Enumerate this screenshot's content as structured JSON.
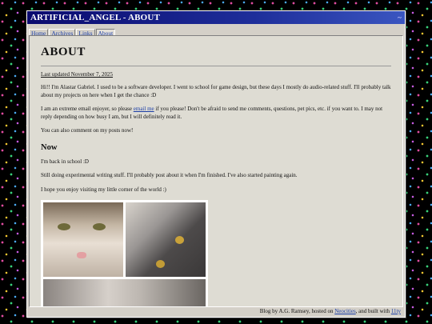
{
  "window": {
    "title": "ARTIFICIAL_ANGEL - ABOUT",
    "control": "~"
  },
  "nav": [
    {
      "label": "Home"
    },
    {
      "label": "Archives"
    },
    {
      "label": "Links"
    },
    {
      "label": "About"
    }
  ],
  "page": {
    "heading": "ABOUT",
    "updated": "Last updated November 7, 2025",
    "intro": "Hi!! I'm Alastar Gabriel. I used to be a software developer. I went to school for game design, but these days I mostly do audio-related stuff. I'll probably talk about my projects on here when I get the chance :D",
    "email_before": "I am an extreme email enjoyer, so please ",
    "email_link": "email me",
    "email_after": " if you please! Don't be afraid to send me comments, questions, pet pics, etc. if you want to. I may not reply depending on how busy I am, but I will definitely read it.",
    "comment": "You can also comment on my posts now!",
    "now_heading": "Now",
    "now_1": "I'm back in school :D",
    "now_2": "Still doing experimental writing stuff. I'll probably post about it when I'm finished. I've also started painting again.",
    "now_3": "I hope you enjoy visiting my little corner of the world :)"
  },
  "footer": {
    "before": "Blog by A.G. Ramsey, hosted on ",
    "link1": "Neocities",
    "middle": ", and built with ",
    "link2": "11ty"
  }
}
